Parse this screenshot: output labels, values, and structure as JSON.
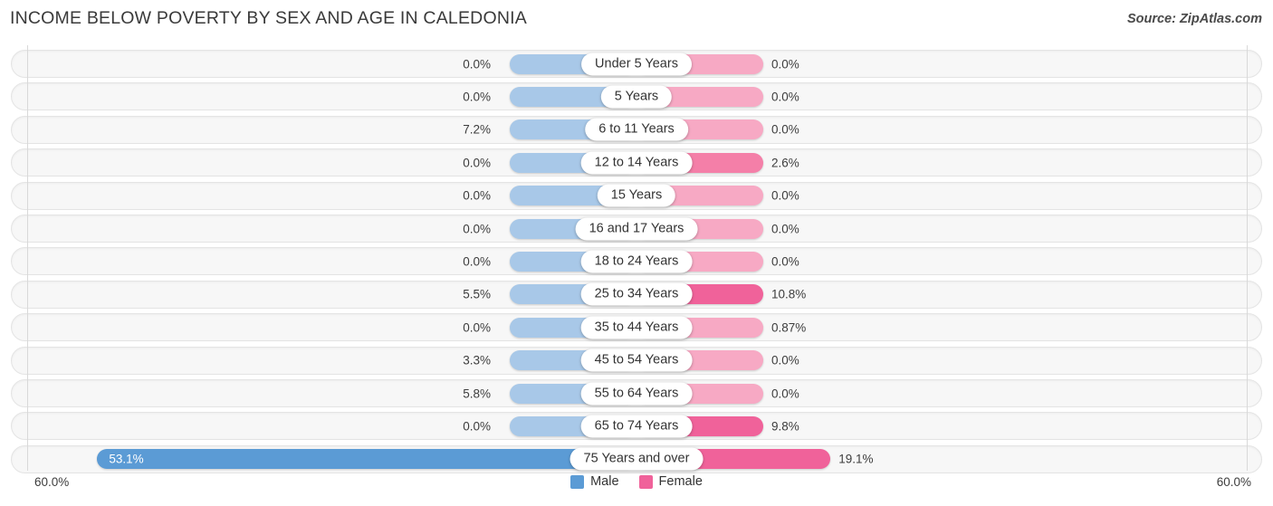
{
  "header": {
    "title": "INCOME BELOW POVERTY BY SEX AND AGE IN CALEDONIA",
    "source": "Source: ZipAtlas.com"
  },
  "axis": {
    "left_label": "60.0%",
    "right_label": "60.0%",
    "max_percent": 60.0
  },
  "legend": {
    "items": [
      {
        "label": "Male",
        "color": "#5b9bd5"
      },
      {
        "label": "Female",
        "color": "#f0629a"
      }
    ]
  },
  "colors": {
    "male_light": "#a8c8e8",
    "male_dark": "#5b9bd5",
    "female_light": "#f7a9c4",
    "female_mid": "#f47fa8",
    "female_dark": "#f0629a",
    "row_background": "#f7f7f7",
    "row_border": "#e4e4e4",
    "gridline": "#d9d9d9"
  },
  "chart_data": {
    "type": "bar",
    "subtype": "diverging-bidirectional",
    "title": "INCOME BELOW POVERTY BY SEX AND AGE IN CALEDONIA",
    "xlabel": "",
    "ylabel": "",
    "xlim": [
      -60.0,
      60.0
    ],
    "grid": true,
    "legend_position": "bottom-center",
    "categories": [
      "Under 5 Years",
      "5 Years",
      "6 to 11 Years",
      "12 to 14 Years",
      "15 Years",
      "16 and 17 Years",
      "18 to 24 Years",
      "25 to 34 Years",
      "35 to 44 Years",
      "45 to 54 Years",
      "55 to 64 Years",
      "65 to 74 Years",
      "75 Years and over"
    ],
    "series": [
      {
        "name": "Male",
        "direction": "left",
        "values": [
          0.0,
          0.0,
          7.2,
          0.0,
          0.0,
          0.0,
          0.0,
          5.5,
          0.0,
          3.3,
          5.8,
          0.0,
          53.1
        ],
        "labels": [
          "0.0%",
          "0.0%",
          "7.2%",
          "0.0%",
          "0.0%",
          "0.0%",
          "0.0%",
          "5.5%",
          "0.0%",
          "3.3%",
          "5.8%",
          "0.0%",
          "53.1%"
        ]
      },
      {
        "name": "Female",
        "direction": "right",
        "values": [
          0.0,
          0.0,
          0.0,
          2.6,
          0.0,
          0.0,
          0.0,
          10.8,
          0.87,
          0.0,
          0.0,
          9.8,
          19.1
        ],
        "labels": [
          "0.0%",
          "0.0%",
          "0.0%",
          "2.6%",
          "0.0%",
          "0.0%",
          "0.0%",
          "10.8%",
          "0.87%",
          "0.0%",
          "0.0%",
          "9.8%",
          "19.1%"
        ]
      }
    ]
  },
  "rows": [
    {
      "category": "Under 5 Years",
      "male": 0.0,
      "male_label": "0.0%",
      "female": 0.0,
      "female_label": "0.0%"
    },
    {
      "category": "5 Years",
      "male": 0.0,
      "male_label": "0.0%",
      "female": 0.0,
      "female_label": "0.0%"
    },
    {
      "category": "6 to 11 Years",
      "male": 7.2,
      "male_label": "7.2%",
      "female": 0.0,
      "female_label": "0.0%"
    },
    {
      "category": "12 to 14 Years",
      "male": 0.0,
      "male_label": "0.0%",
      "female": 2.6,
      "female_label": "2.6%"
    },
    {
      "category": "15 Years",
      "male": 0.0,
      "male_label": "0.0%",
      "female": 0.0,
      "female_label": "0.0%"
    },
    {
      "category": "16 and 17 Years",
      "male": 0.0,
      "male_label": "0.0%",
      "female": 0.0,
      "female_label": "0.0%"
    },
    {
      "category": "18 to 24 Years",
      "male": 0.0,
      "male_label": "0.0%",
      "female": 0.0,
      "female_label": "0.0%"
    },
    {
      "category": "25 to 34 Years",
      "male": 5.5,
      "male_label": "5.5%",
      "female": 10.8,
      "female_label": "10.8%"
    },
    {
      "category": "35 to 44 Years",
      "male": 0.0,
      "male_label": "0.0%",
      "female": 0.87,
      "female_label": "0.87%"
    },
    {
      "category": "45 to 54 Years",
      "male": 3.3,
      "male_label": "3.3%",
      "female": 0.0,
      "female_label": "0.0%"
    },
    {
      "category": "55 to 64 Years",
      "male": 5.8,
      "male_label": "5.8%",
      "female": 0.0,
      "female_label": "0.0%"
    },
    {
      "category": "65 to 74 Years",
      "male": 0.0,
      "male_label": "0.0%",
      "female": 9.8,
      "female_label": "9.8%"
    },
    {
      "category": "75 Years and over",
      "male": 53.1,
      "male_label": "53.1%",
      "female": 19.1,
      "female_label": "19.1%"
    }
  ]
}
